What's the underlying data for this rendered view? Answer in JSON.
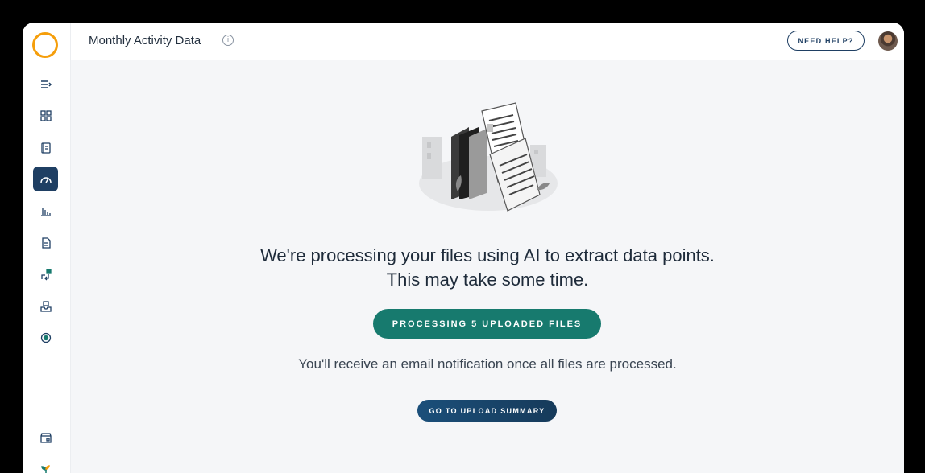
{
  "header": {
    "title": "Monthly Activity Data",
    "info_icon": "info-icon",
    "help_label": "NEED HELP?",
    "avatar_icon": "user-avatar"
  },
  "sidebar": {
    "logo_icon": "ring-logo",
    "items": [
      {
        "icon": "collapse-menu-icon"
      },
      {
        "icon": "dashboard-grid-icon"
      },
      {
        "icon": "book-icon"
      },
      {
        "icon": "gauge-icon",
        "active": true
      },
      {
        "icon": "bar-chart-icon"
      },
      {
        "icon": "document-icon"
      },
      {
        "icon": "data-transfer-icon"
      },
      {
        "icon": "inbox-tray-icon"
      },
      {
        "icon": "settings-gear-icon"
      },
      {
        "icon": "store-icon"
      },
      {
        "icon": "plant-icon"
      }
    ]
  },
  "main": {
    "illustration": "documents-processing-illustration",
    "message_line1": "We're processing your files using AI to extract data points.",
    "message_line2": "This may take some time.",
    "processing_label": "PROCESSING 5 UPLOADED FILES",
    "note": "You'll receive an email notification once all files are processed.",
    "summary_label": "GO TO UPLOAD SUMMARY"
  },
  "colors": {
    "accent": "#177a6e",
    "navy": "#1f3f63",
    "logo": "#f59e0b",
    "background": "#f5f6f8"
  }
}
